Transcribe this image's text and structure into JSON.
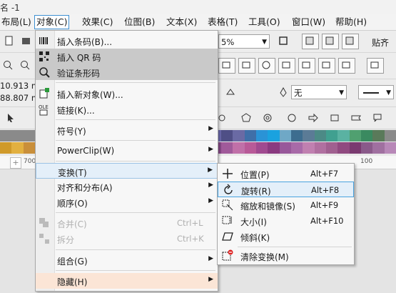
{
  "window": {
    "title": "名 -1"
  },
  "menubar": [
    {
      "label": "布局(L)"
    },
    {
      "label": "对象(C)",
      "active": true
    },
    {
      "label": "效果(C)"
    },
    {
      "label": "位图(B)"
    },
    {
      "label": "文本(X)"
    },
    {
      "label": "表格(T)"
    },
    {
      "label": "工具(O)"
    },
    {
      "label": "窗口(W)"
    },
    {
      "label": "帮助(H)"
    }
  ],
  "toolbar": {
    "zoom_value": "5%",
    "align_label": "贴齐",
    "x_value": "10.913 m",
    "y_value": "88.807 m",
    "outline_value": "无"
  },
  "ruler": {
    "ticks": [
      "700",
      "100"
    ]
  },
  "object_menu": {
    "items": [
      {
        "label": "插入条码(B)...",
        "icon": "barcode-icon"
      },
      {
        "label": "插入 QR 码",
        "icon": "qr-code-icon",
        "highlight": true
      },
      {
        "label": "验证条形码",
        "icon": "verify-barcode-icon",
        "highlight": true
      },
      {
        "label": "插入新对象(W)...",
        "icon": "insert-object-icon"
      },
      {
        "label": "链接(K)...",
        "icon": "ole-link-icon"
      },
      {
        "label": "符号(Y)",
        "submenu": true
      },
      {
        "label": "PowerClip(W)",
        "submenu": true
      },
      {
        "label": "变换(T)",
        "submenu": true,
        "open": true
      },
      {
        "label": "对齐和分布(A)",
        "submenu": true
      },
      {
        "label": "顺序(O)",
        "submenu": true
      },
      {
        "label": "合并(C)",
        "shortcut": "Ctrl+L",
        "disabled": true,
        "icon": "combine-icon"
      },
      {
        "label": "拆分",
        "shortcut": "Ctrl+K",
        "disabled": true,
        "icon": "break-apart-icon"
      },
      {
        "label": "组合(G)",
        "submenu": true
      },
      {
        "label": "隐藏(H)",
        "submenu": true
      }
    ]
  },
  "transform_submenu": {
    "items": [
      {
        "label": "位置(P)",
        "shortcut": "Alt+F7",
        "icon": "position-icon"
      },
      {
        "label": "旋转(R)",
        "shortcut": "Alt+F8",
        "icon": "rotate-icon",
        "highlight": true
      },
      {
        "label": "缩放和镜像(S)",
        "shortcut": "Alt+F9",
        "icon": "scale-mirror-icon"
      },
      {
        "label": "大小(I)",
        "shortcut": "Alt+F10",
        "icon": "size-icon"
      },
      {
        "label": "倾斜(K)",
        "shortcut": "",
        "icon": "skew-icon"
      },
      {
        "label": "清除变换(M)",
        "shortcut": "",
        "icon": "clear-transform-icon"
      }
    ]
  },
  "palette": {
    "row1": [
      "#8a8a8a",
      "#8a8a8a",
      "#8a8a8a",
      "#8a8a8a",
      "#8a8a8a",
      "#8a8a8a",
      "#8a8a8a",
      "#8a8a8a",
      "#8a8a8a",
      "#8a8a8a",
      "#8a8a8a",
      "#8a8a8a",
      "#8a8a8a",
      "#8a8a8a",
      "#8a8a8a",
      "#8a8a8a",
      "#8a8a8a",
      "#8a8a8a",
      "#6d6bb0",
      "#4f4f86",
      "#6a6aa4",
      "#3f6fa8",
      "#2a93d6",
      "#1aa2df",
      "#6fa8c6",
      "#3d6d8f",
      "#5b7b96",
      "#4c8a86",
      "#40a090",
      "#5ab2a2",
      "#50a070",
      "#3a8a60",
      "#5a7a5a",
      "#8a8a8a"
    ],
    "row2": [
      "#d09a2a",
      "#e2b040",
      "#c98f3a",
      "#b07030",
      "#a05030",
      "#9a4040",
      "#8a3a50",
      "#7a3a6a",
      "#6a3a7a",
      "#804080",
      "#a04890",
      "#b85090",
      "#c85080",
      "#b84060",
      "#a04050",
      "#9a5070",
      "#8a5a80",
      "#7a5a90",
      "#8a4a8a",
      "#a05a9a",
      "#c070a8",
      "#b85a98",
      "#a04a90",
      "#8a3a80",
      "#98589a",
      "#a86aa8",
      "#c080b0",
      "#b070a0",
      "#a06090",
      "#904a80",
      "#7a3a70",
      "#8a5a8a",
      "#a070a0",
      "#b888b8"
    ]
  }
}
